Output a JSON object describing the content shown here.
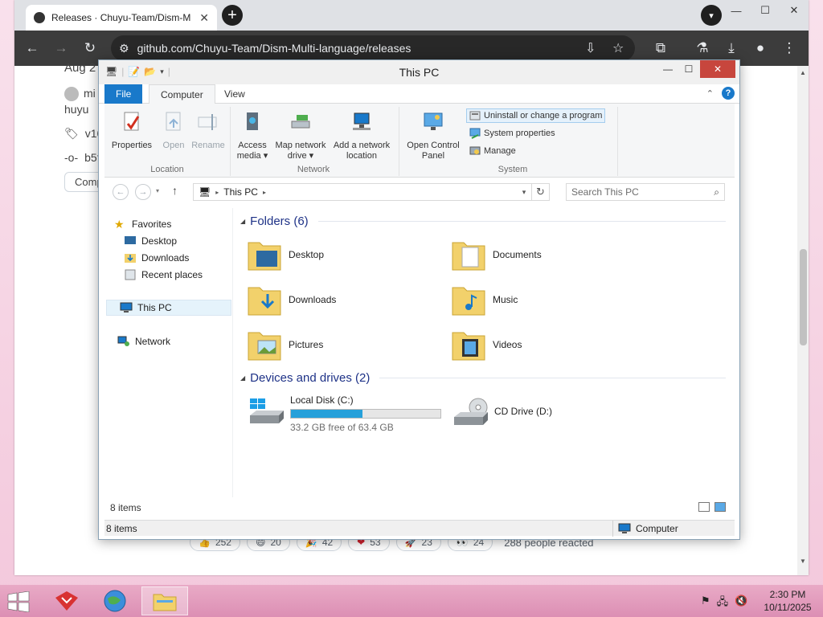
{
  "browser": {
    "tab_title": "Releases · Chuyu-Team/Dism-M",
    "url": "github.com/Chuyu-Team/Dism-Multi-language/releases",
    "tab_close": "✕",
    "new_tab": "+",
    "win_min": "—",
    "win_max": "☐",
    "win_close": "✕"
  },
  "github": {
    "date_partial": "Aug 2",
    "author_partial": "mi",
    "author2": "huyu",
    "tag_partial": "v10",
    "commit_partial": "b5f",
    "compare_partial": "Comp",
    "reactions": [
      {
        "emoji": "👍",
        "count": "252"
      },
      {
        "emoji": "😄",
        "count": "20"
      },
      {
        "emoji": "🎉",
        "count": "42"
      },
      {
        "emoji": "❤",
        "count": "53"
      },
      {
        "emoji": "🚀",
        "count": "23"
      },
      {
        "emoji": "👀",
        "count": "24"
      }
    ],
    "reaction_summary": "288 people reacted"
  },
  "explorer": {
    "title": "This PC",
    "ribbon_tabs": [
      "File",
      "Computer",
      "View"
    ],
    "location": {
      "label": "Location",
      "properties": "Properties",
      "open": "Open",
      "rename": "Rename"
    },
    "network": {
      "label": "Network",
      "access_media_1": "Access",
      "access_media_2": "media ▾",
      "map_drive_1": "Map network",
      "map_drive_2": "drive ▾",
      "add_location_1": "Add a network",
      "add_location_2": "location"
    },
    "system": {
      "label": "System",
      "open_cp_1": "Open Control",
      "open_cp_2": "Panel",
      "uninstall": "Uninstall or change a program",
      "sys_props": "System properties",
      "manage": "Manage"
    },
    "address": {
      "path": "This PC"
    },
    "search_placeholder": "Search This PC",
    "nav": {
      "favorites": "Favorites",
      "desktop": "Desktop",
      "downloads": "Downloads",
      "recent": "Recent places",
      "this_pc": "This PC",
      "network": "Network"
    },
    "folders_heading": "Folders (6)",
    "folders": [
      "Desktop",
      "Documents",
      "Downloads",
      "Music",
      "Pictures",
      "Videos"
    ],
    "devices_heading": "Devices and drives (2)",
    "local_disk": {
      "name": "Local Disk (C:)",
      "free": "33.2 GB free of 63.4 GB",
      "used_fraction": 0.476
    },
    "cd_drive": {
      "name": "CD Drive (D:)"
    },
    "item_count": "8 items",
    "status_count": "8 items",
    "status_location": "Computer"
  },
  "taskbar": {
    "time": "2:30 PM",
    "date": "10/11/2025"
  },
  "colors": {
    "accent": "#1979ca",
    "heading": "#1e3287",
    "drive_fill": "#26a0da",
    "close": "#c7463d"
  }
}
